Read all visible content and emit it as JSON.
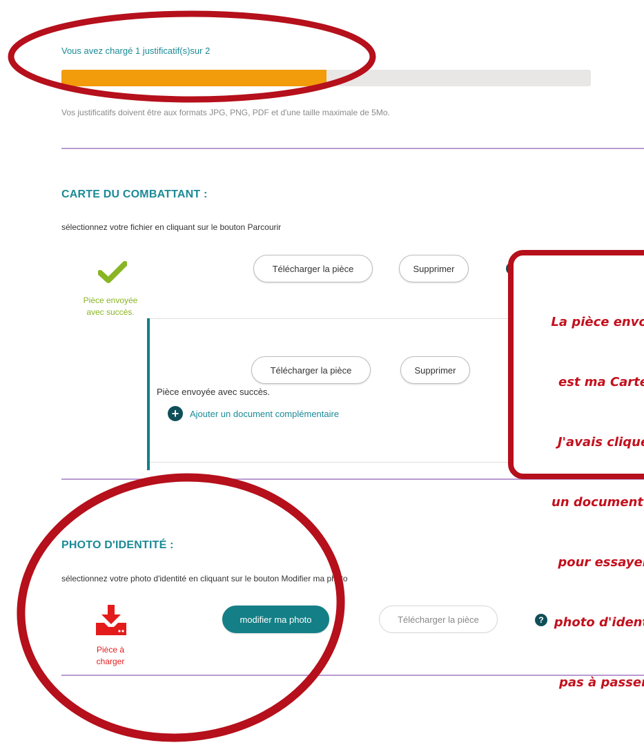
{
  "upload": {
    "count_text": "Vous avez chargé 1 justificatif(s)sur 2",
    "uploaded": 1,
    "total": 2,
    "progress_fraction": 0.5,
    "format_note": "Vos justificatifs doivent être aux formats JPG, PNG, PDF et d'une taille maximale de 5Mo."
  },
  "colors": {
    "accent_teal": "#1a8a96",
    "progress_fill": "#f29b0b",
    "success_green": "#8ab524",
    "error_red": "#e31b1b",
    "annotation_red": "#b5101b"
  },
  "carte": {
    "title": "CARTE DU COMBATTANT :",
    "instruction": "sélectionnez votre fichier en cliquant sur le bouton Parcourir",
    "status_icon": "check-icon",
    "status_line1": "Pièce envoyée",
    "status_line2": "avec succès.",
    "download_label": "Télécharger la pièce",
    "delete_label": "Supprimer",
    "help_icon": "question-icon",
    "sub": {
      "download_label": "Télécharger la pièce",
      "delete_label": "Supprimer",
      "status": "Pièce envoyée avec succès.",
      "add_label": "Ajouter un document complémentaire",
      "add_icon": "plus-circle-icon"
    }
  },
  "photo": {
    "title": "PHOTO D'IDENTITÉ :",
    "instruction": "sélectionnez votre photo d'identité en cliquant sur le bouton Modifier ma photo",
    "status_icon": "download-tray-icon",
    "status_line1": "Pièce à",
    "status_line2": "charger",
    "modify_label": "modifier ma photo",
    "download_label": "Télécharger la pièce",
    "help_icon": "question-icon"
  },
  "annotation": {
    "lines": [
      "La pièce envoy",
      "est ma Carte",
      "J'avais cliqué",
      "un document c",
      "pour essayer",
      "photo d'identi",
      "pas à passer"
    ]
  }
}
